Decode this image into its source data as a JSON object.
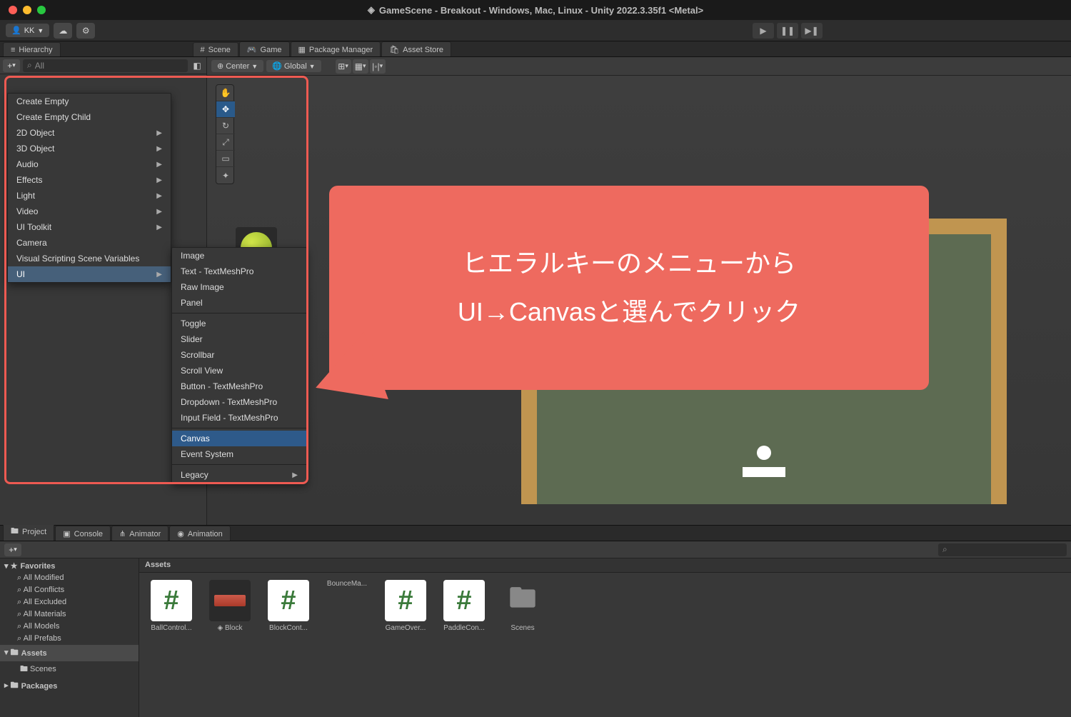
{
  "title": "GameScene - Breakout - Windows, Mac, Linux - Unity 2022.3.35f1 <Metal>",
  "account": {
    "user": "KK"
  },
  "tabs": {
    "hierarchy": "Hierarchy",
    "scene": "Scene",
    "game": "Game",
    "package_manager": "Package Manager",
    "asset_store": "Asset Store"
  },
  "hierarchy": {
    "search_placeholder": "All"
  },
  "scene_toolbar": {
    "pivot": "Center",
    "space": "Global"
  },
  "context_menu_1": [
    {
      "label": "Create Empty"
    },
    {
      "label": "Create Empty Child"
    },
    {
      "label": "2D Object",
      "sub": true
    },
    {
      "label": "3D Object",
      "sub": true
    },
    {
      "label": "Audio",
      "sub": true
    },
    {
      "label": "Effects",
      "sub": true
    },
    {
      "label": "Light",
      "sub": true
    },
    {
      "label": "Video",
      "sub": true
    },
    {
      "label": "UI Toolkit",
      "sub": true
    },
    {
      "label": "Camera"
    },
    {
      "label": "Visual Scripting Scene Variables"
    },
    {
      "label": "UI",
      "sub": true,
      "selected": true
    }
  ],
  "context_menu_2": {
    "group1": [
      "Image",
      "Text - TextMeshPro",
      "Raw Image",
      "Panel"
    ],
    "group2": [
      "Toggle",
      "Slider",
      "Scrollbar",
      "Scroll View",
      "Button - TextMeshPro",
      "Dropdown - TextMeshPro",
      "Input Field - TextMeshPro"
    ],
    "group3": [
      "Canvas",
      "Event System"
    ],
    "group4": [
      {
        "label": "Legacy",
        "sub": true
      }
    ],
    "highlighted": "Canvas"
  },
  "callout": {
    "line1": "ヒエラルキーのメニューから",
    "line2": "UI→Canvasと選んでクリック"
  },
  "project": {
    "tabs": {
      "project": "Project",
      "console": "Console",
      "animator": "Animator",
      "animation": "Animation"
    },
    "favorites_label": "Favorites",
    "favorites": [
      "All Modified",
      "All Conflicts",
      "All Excluded",
      "All Materials",
      "All Models",
      "All Prefabs"
    ],
    "assets_label": "Assets",
    "assets_children": [
      "Scenes"
    ],
    "packages_label": "Packages",
    "content_header": "Assets",
    "assets": [
      {
        "name": "BallControl...",
        "type": "script"
      },
      {
        "name": "Block",
        "type": "block"
      },
      {
        "name": "BlockCont...",
        "type": "script"
      },
      {
        "name": "BounceMa...",
        "type": "ball"
      },
      {
        "name": "GameOver...",
        "type": "script"
      },
      {
        "name": "PaddleCon...",
        "type": "script"
      },
      {
        "name": "Scenes",
        "type": "folder"
      }
    ]
  }
}
